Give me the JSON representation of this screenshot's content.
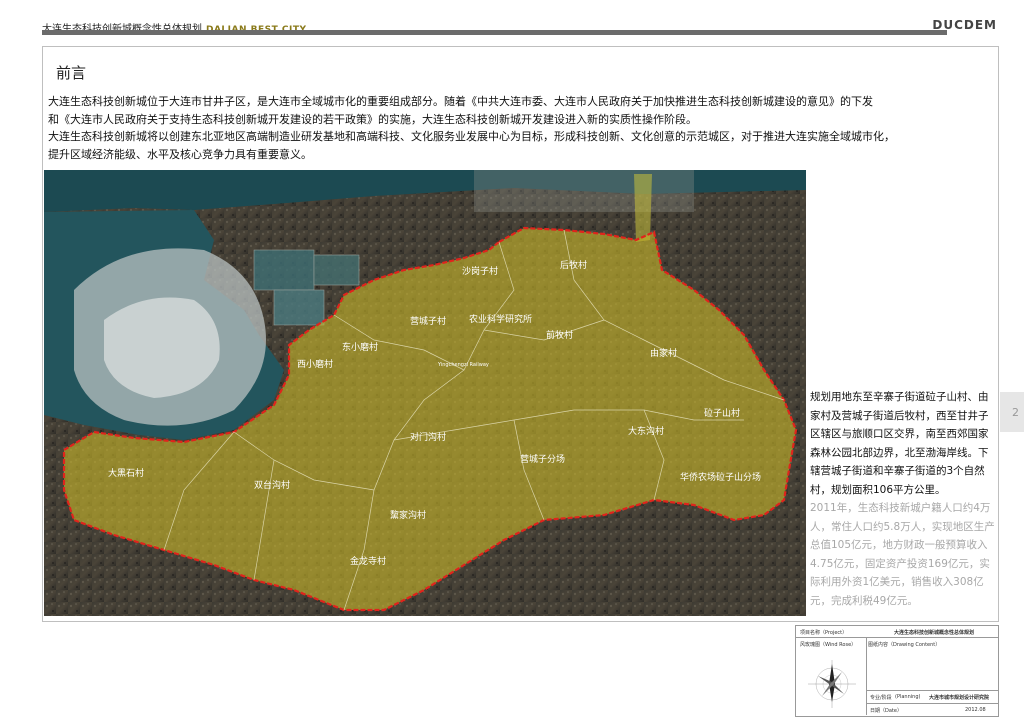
{
  "header": {
    "project_cn": "大连生态科技创新城概念性总体规划",
    "project_en": "DALIAN BEST CITY",
    "logo": "DUCDEM"
  },
  "title": "前言",
  "intro": [
    "大连生态科技创新城位于大连市甘井子区，是大连市全域城市化的重要组成部分。随着《中共大连市委、大连市人民政府关于加快推进生态科技创新城建设的意见》的下发",
    "和《大连市人民政府关于支持生态科技创新城开发建设的若干政策》的实施，大连生态科技创新城开发建设进入新的实质性操作阶段。",
    "大连生态科技创新城将以创建东北亚地区高端制造业研发基地和高端科技、文化服务业发展中心为目标，形成科技创新、文化创意的示范城区，对于推进大连实施全域城市化，",
    "提升区域经济能级、水平及核心竞争力具有重要意义。"
  ],
  "map": {
    "labels": [
      {
        "id": "houmu",
        "text": "后牧村"
      },
      {
        "id": "shagang",
        "text": "沙岗子村"
      },
      {
        "id": "yingchengzi",
        "text": "营城子村"
      },
      {
        "id": "nongye",
        "text": "农业科学研究所"
      },
      {
        "id": "dongxiaomo",
        "text": "东小磨村"
      },
      {
        "id": "qianmu",
        "text": "前牧村"
      },
      {
        "id": "xixiaomo",
        "text": "西小磨村"
      },
      {
        "id": "railway",
        "text": "Yingchengzi Railway"
      },
      {
        "id": "youjia",
        "text": "由家村"
      },
      {
        "id": "shazishan",
        "text": "砬子山村"
      },
      {
        "id": "dadonggou",
        "text": "大东沟村"
      },
      {
        "id": "duimengou",
        "text": "对门沟村"
      },
      {
        "id": "dahei",
        "text": "大黑石村"
      },
      {
        "id": "yingfen",
        "text": "营城子分场"
      },
      {
        "id": "huaqiao",
        "text": "华侨农场砬子山分场"
      },
      {
        "id": "shuangtai",
        "text": "双台沟村"
      },
      {
        "id": "lijia",
        "text": "黧家沟村"
      },
      {
        "id": "jinlong",
        "text": "金龙寺村"
      }
    ]
  },
  "side": {
    "dark": "规划用地东至辛寨子街道砬子山村、由家村及营城子街道后牧村，西至甘井子区辖区与旅顺口区交界，南至西郊国家森林公园北部边界，北至渤海岸线。下辖营城子街道和辛寨子街道的3个自然村，规划面积106平方公里。",
    "gray": "2011年，生态科技新城户籍人口约4万人，常住人口约5.8万人，实现地区生产总值105亿元，地方财政一般预算收入4.75亿元，固定资产投资169亿元，实际利用外资1亿美元，销售收入308亿元，完成利税49亿元。"
  },
  "page_number": "2",
  "title_block": {
    "project_label": "项目名称（Project）",
    "project_value": "大连生态科技创新城概念性总体规划",
    "wind_label": "风玫瑰图（Wind Rose）",
    "content_label": "图纸内容（Drawing Content）",
    "discipline_label": "专业/阶段",
    "discipline_en": "(Planning)",
    "institute": "大连市城市规划设计研究院",
    "date_label": "日期（Date）",
    "date_value": "2012.08"
  }
}
